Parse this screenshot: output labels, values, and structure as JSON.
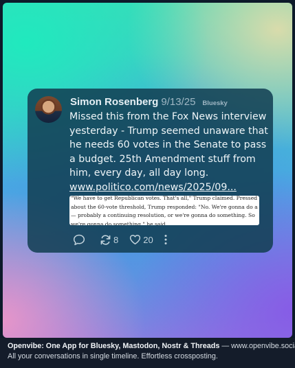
{
  "post": {
    "author": "Simon Rosenberg",
    "date": "9/13/25",
    "network": "Bluesky",
    "text": "Missed this from the Fox News interview yesterday - Trump seemed unaware that he needs 60 votes in the Senate to pass a budget.  25th Amendment stuff from him, every day, all day long. ",
    "link_text": "www.politico.com/news/2025/09...",
    "quote_text": "\"We have to get Republican votes. That's all,\" Trump claimed. Pressed about the 60-vote threshold, Trump responded: \"No. We're gonna do a — probably a continuing resolution, or we're gonna do something. So we're gonna do something,\" he said.",
    "reposts": "8",
    "likes": "20"
  },
  "footer": {
    "brand": "Openvibe: One App for Bluesky, Mastodon, Nostr & Threads",
    "separator": " — ",
    "url": "www.openvibe.social",
    "tagline": "All your conversations in single timeline. Effortless crossposting."
  },
  "icons": {
    "reply": "speech-bubble-icon",
    "repost": "repost-arrows-icon",
    "like": "heart-icon",
    "more": "vertical-dots-icon"
  },
  "colors": {
    "card_bg": "#123e52",
    "footer_bg": "#141c2a",
    "text": "#eef5f8",
    "muted": "#9fb7c4"
  }
}
